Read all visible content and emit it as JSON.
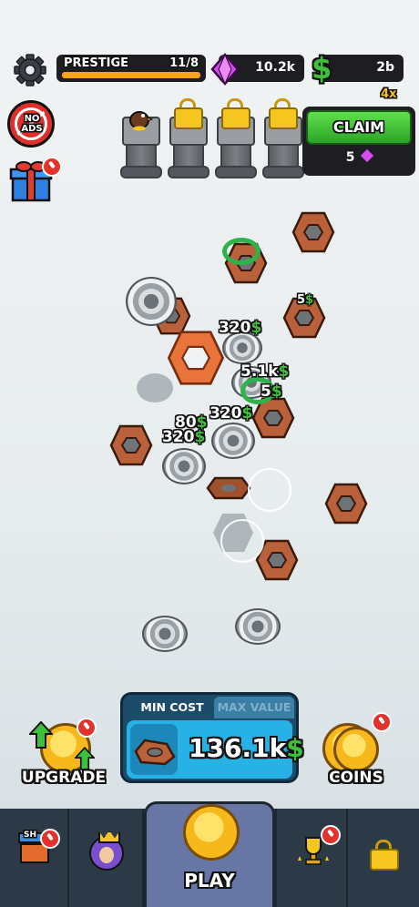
{
  "top_bar": {
    "prestige_label": "PRESTIGE",
    "prestige_count": "11/8",
    "prestige_progress": 1.0,
    "gems_value": "10.2k",
    "cash_value": "2b",
    "multiplier": "4x"
  },
  "side": {
    "no_ads_label": "NO ADS"
  },
  "claim": {
    "button_label": "CLAIM",
    "cost_value": "5"
  },
  "floating_values": {
    "v1": "320",
    "v2": "5",
    "v3": "5.1k",
    "v4": "5",
    "v5": "320",
    "v6": "80",
    "v7": "320",
    "currency_symbol": "$"
  },
  "price_panel": {
    "tab_min": "MIN COST",
    "tab_max": "MAX VALUE",
    "value": "136.1k",
    "currency_symbol": "$"
  },
  "actions": {
    "upgrade_label": "UPGRADE",
    "coins_label": "COINS"
  },
  "nav": {
    "shop_sign": "SH",
    "play_label": "PLAY"
  },
  "colors": {
    "nut_brown": "#b8613a",
    "nut_orange": "#e8733b",
    "gem_pink": "#d54df0",
    "cash_green": "#3fbf3a",
    "claim_green": "#44c437",
    "panel_blue": "#27b2e6",
    "nav_bg": "#2c3946",
    "play_bg": "#6876a6"
  },
  "icons": [
    "gear-icon",
    "gem-icon",
    "dollar-icon",
    "no-ads-icon",
    "gift-icon",
    "lock-icon",
    "nut-icon",
    "washer-icon",
    "coin-icon",
    "shop-icon",
    "king-icon",
    "trophy-icon"
  ]
}
